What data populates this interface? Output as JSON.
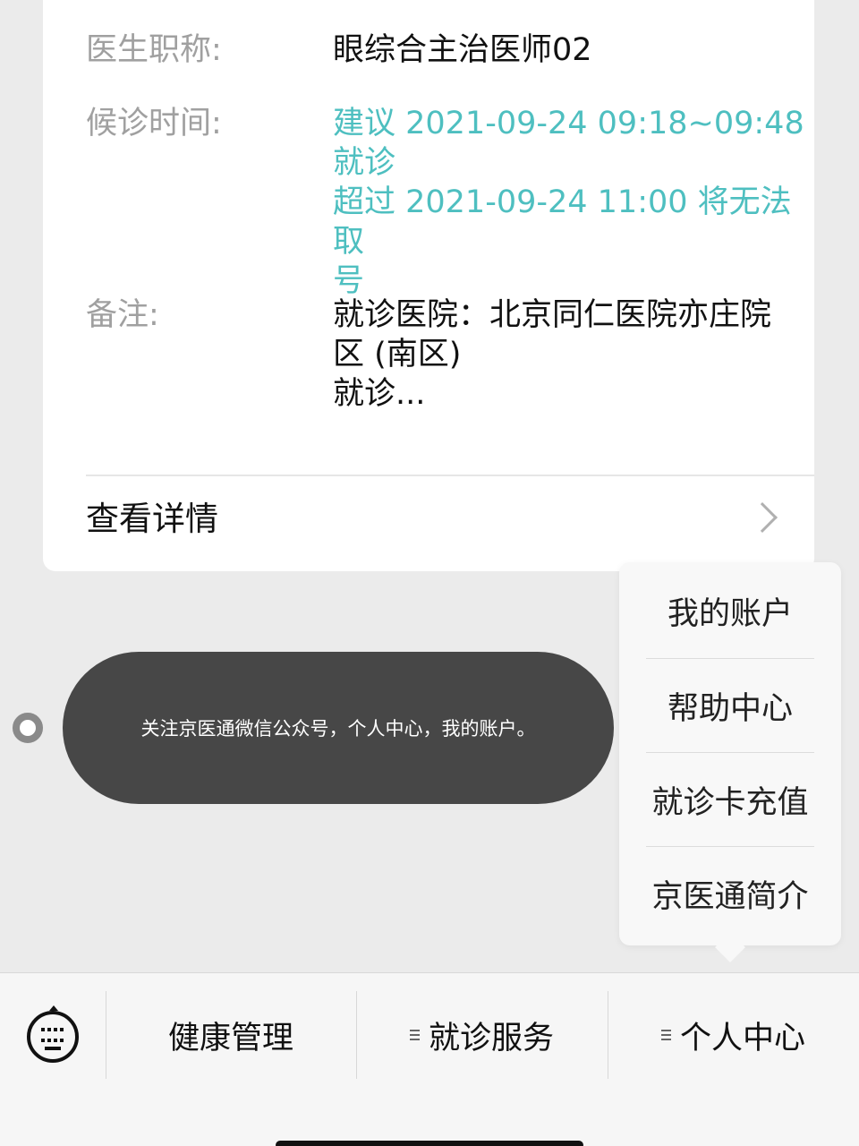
{
  "appointment": {
    "doctor_title_label": "医生职称:",
    "doctor_title_value": "眼综合主治医师02",
    "wait_time_label": "候诊时间:",
    "wait_time_value": "建议 2021-09-24 09:18~09:48\n就诊\n超过 2021-09-24 11:00 将无法取\n号",
    "note_label": "备注:",
    "note_value": "就诊医院：北京同仁医院亦庄院\n区 (南区)\n就诊...",
    "details_label": "查看详情"
  },
  "toast": {
    "text": "关注京医通微信公众号，个人中心，我的账户。"
  },
  "popup_menu": {
    "items": [
      "我的账户",
      "帮助中心",
      "就诊卡充值",
      "京医通简介"
    ]
  },
  "bottom_menu": {
    "tabs": [
      "健康管理",
      "就诊服务",
      "个人中心"
    ]
  },
  "colors": {
    "accent_teal": "#4ebfc0",
    "toast_bg": "#474747"
  }
}
